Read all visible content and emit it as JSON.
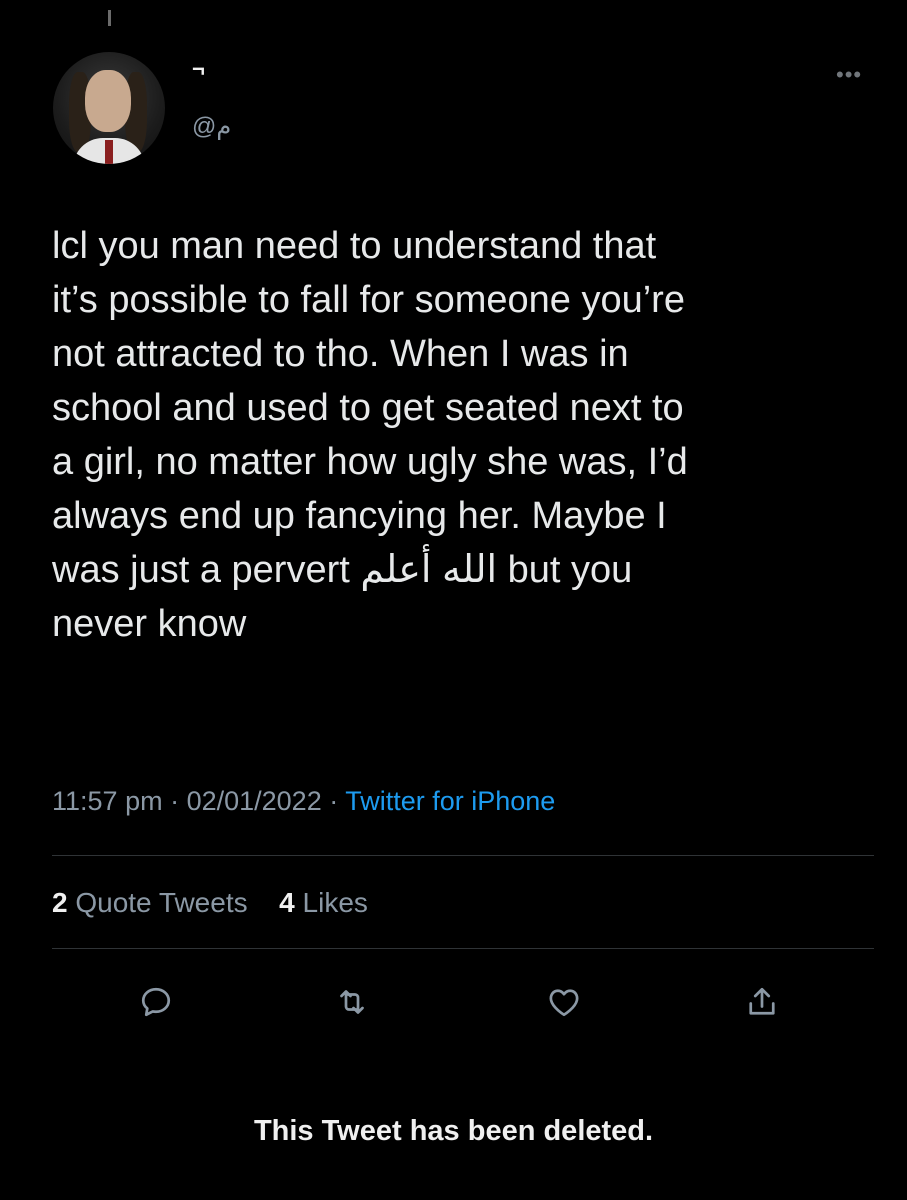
{
  "author": {
    "display_name": "¬",
    "handle": "@م"
  },
  "menu": {
    "more_icon": "more-horizontal-icon",
    "more_label": "•••"
  },
  "tweet": {
    "text": "lcl you man need to understand that\nit’s possible to fall for someone you’re\nnot attracted to tho. When I was in\nschool and used to get seated next to\na girl, no matter how ugly she was, I’d\nalways end up fancying her. Maybe I\nwas just a pervert الله أعلم but you\nnever know"
  },
  "meta": {
    "time": "11:57 pm",
    "separator": " · ",
    "date": "02/01/2022",
    "source": "Twitter for iPhone"
  },
  "stats": {
    "quote_tweets_count": "2",
    "quote_tweets_label": " Quote Tweets",
    "likes_count": "4",
    "likes_label": " Likes"
  },
  "actions": [
    "reply-icon",
    "retweet-icon",
    "like-icon",
    "share-icon"
  ],
  "colors": {
    "background": "#000000",
    "text": "#e7e9ea",
    "secondary_text": "#8b98a5",
    "link": "#1d9bf0",
    "divider": "#2f3336"
  },
  "notice": {
    "deleted_text": "This Tweet has been deleted."
  }
}
